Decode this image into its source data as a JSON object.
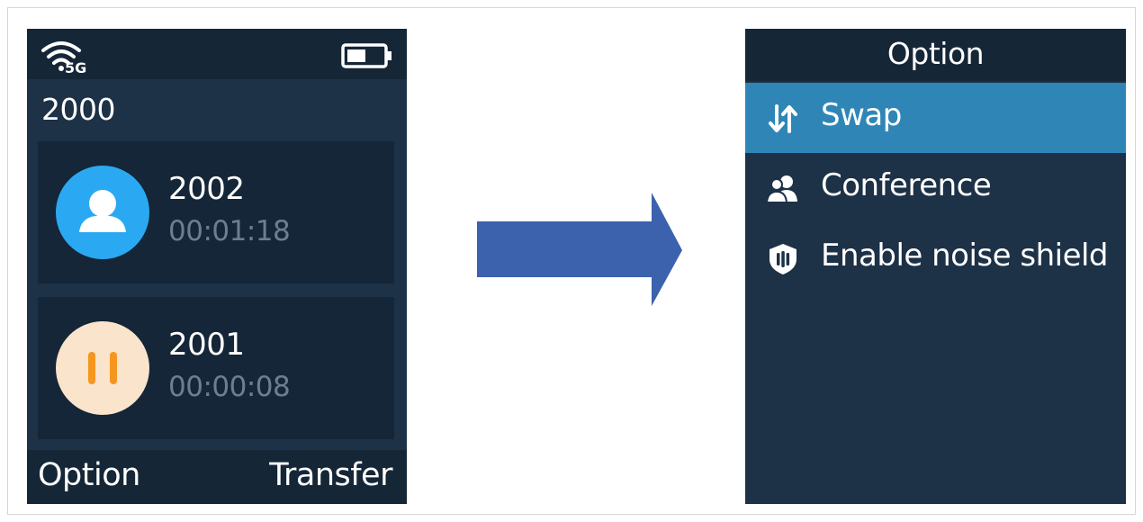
{
  "colors": {
    "screen_bg": "#1d3147",
    "bar_bg": "#152637",
    "card_bg": "#142637",
    "selected_bg": "#2f86b6",
    "active_avatar": "#2aa9f2",
    "hold_avatar": "#fbe4cc",
    "hold_icon": "#f5961f",
    "arrow": "#3d62ad"
  },
  "call_screen": {
    "status": {
      "network_label": "5G",
      "wifi_icon": "wifi-icon",
      "battery_icon": "battery-icon"
    },
    "line": "2000",
    "calls": [
      {
        "number": "2002",
        "duration": "00:01:18",
        "state": "active",
        "icon": "contact-icon"
      },
      {
        "number": "2001",
        "duration": "00:00:08",
        "state": "hold",
        "icon": "pause-icon"
      }
    ],
    "softkeys": {
      "left": "Option",
      "right": "Transfer"
    }
  },
  "option_screen": {
    "title": "Option",
    "items": [
      {
        "label": "Swap",
        "icon": "swap-icon",
        "selected": true
      },
      {
        "label": "Conference",
        "icon": "conference-icon",
        "selected": false
      },
      {
        "label": "Enable noise shield",
        "icon": "noise-shield-icon",
        "selected": false
      }
    ]
  }
}
